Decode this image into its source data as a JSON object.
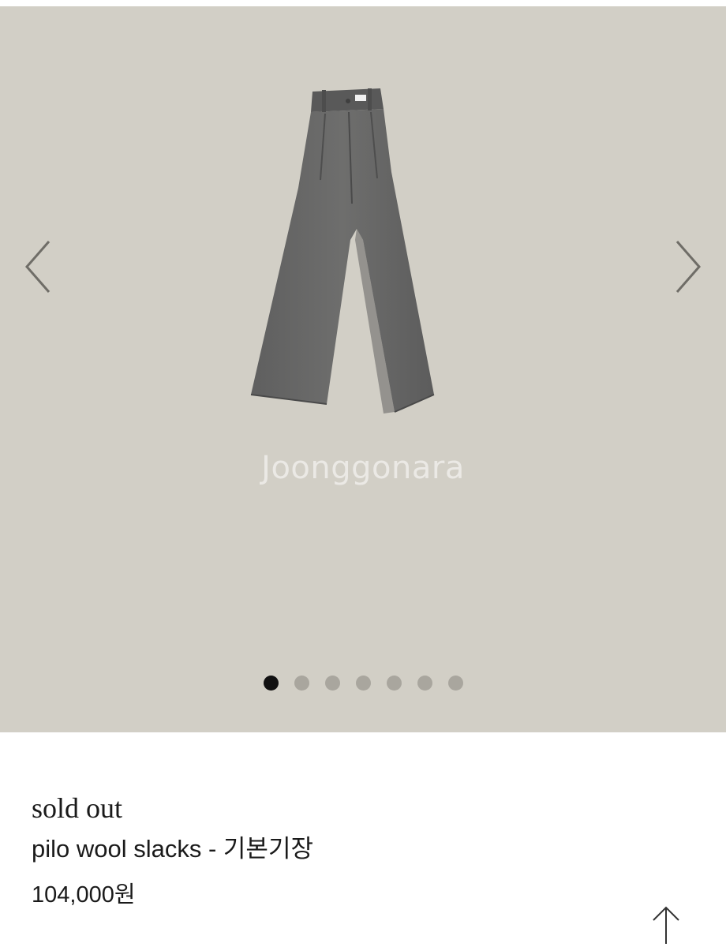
{
  "gallery": {
    "watermark": "Joonggonara",
    "slide_count": 7,
    "active_slide": 1,
    "background_color": "#d2cfc6",
    "icons": {
      "prev": "chevron-left-icon",
      "next": "chevron-right-icon"
    }
  },
  "product": {
    "status": "sold out",
    "name": "pilo wool slacks - 기본기장",
    "price": "104,000원"
  },
  "footer": {
    "scroll_top_icon": "arrow-up-icon"
  }
}
